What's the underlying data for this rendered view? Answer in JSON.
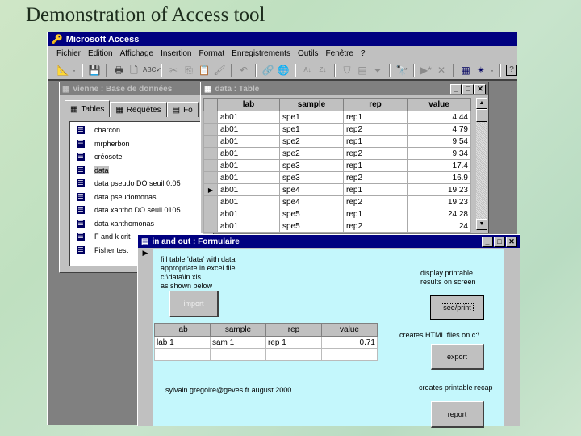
{
  "slide": {
    "title": "Demonstration of Access tool"
  },
  "app": {
    "title": "Microsoft Access",
    "menu": [
      "Fichier",
      "Edition",
      "Affichage",
      "Insertion",
      "Format",
      "Enregistrements",
      "Outils",
      "Fenêtre",
      "?"
    ],
    "toolbar_icons": [
      "design-view-icon",
      "dropdown-arrow-icon",
      "save-icon",
      "print-icon",
      "print-preview-icon",
      "spelling-icon",
      "cut-icon",
      "copy-icon",
      "paste-icon",
      "format-painter-icon",
      "undo-icon",
      "insert-hyperlink-icon",
      "web-toolbar-icon",
      "sort-ascending-icon",
      "sort-descending-icon",
      "filter-by-selection-icon",
      "filter-by-form-icon",
      "apply-filter-icon",
      "find-icon",
      "new-record-icon",
      "delete-record-icon",
      "database-window-icon",
      "new-object-icon",
      "new-object-dropdown-icon",
      "help-icon"
    ]
  },
  "database_window": {
    "title": "vienne : Base de données",
    "tabs": [
      {
        "label": "Tables",
        "active": true
      },
      {
        "label": "Requêtes",
        "active": false
      },
      {
        "label": "Fo",
        "active": false
      }
    ],
    "items": [
      {
        "label": "charcon",
        "selected": false
      },
      {
        "label": "mrpherbon",
        "selected": false
      },
      {
        "label": "créosote",
        "selected": false
      },
      {
        "label": "data",
        "selected": true
      },
      {
        "label": "data pseudo DO seuil 0.05",
        "selected": false
      },
      {
        "label": "data pseudomonas",
        "selected": false
      },
      {
        "label": "data xantho DO seuil 0105",
        "selected": false
      },
      {
        "label": "data xanthomonas",
        "selected": false
      },
      {
        "label": "F and k crit",
        "selected": false
      },
      {
        "label": "Fisher test",
        "selected": false
      }
    ]
  },
  "data_table": {
    "title": "data : Table",
    "columns": [
      "lab",
      "sample",
      "rep",
      "value"
    ],
    "rows": [
      [
        "ab01",
        "spe1",
        "rep1",
        "4.44"
      ],
      [
        "ab01",
        "spe1",
        "rep2",
        "4.79"
      ],
      [
        "ab01",
        "spe2",
        "rep1",
        "9.54"
      ],
      [
        "ab01",
        "spe2",
        "rep2",
        "9.34"
      ],
      [
        "ab01",
        "spe3",
        "rep1",
        "17.4"
      ],
      [
        "ab01",
        "spe3",
        "rep2",
        "16.9"
      ],
      [
        "ab01",
        "spe4",
        "rep1",
        "19.23"
      ],
      [
        "ab01",
        "spe4",
        "rep2",
        "19.23"
      ],
      [
        "ab01",
        "spe5",
        "rep1",
        "24.28"
      ],
      [
        "ab01",
        "spe5",
        "rep2",
        "24"
      ]
    ],
    "current_row_index": 6
  },
  "form": {
    "title": "in and out : Formulaire",
    "instructions": [
      "fill table 'data' with data",
      "appropriate in excel file",
      "c:\\data\\in.xls",
      "as shown below"
    ],
    "import_button": "import",
    "display_text": [
      "display printable",
      "results on screen"
    ],
    "see_print_button": "see/print",
    "export_text": "creates HTML files on c:\\",
    "export_button": "export",
    "recap_text": "creates printable recap",
    "report_button": "report",
    "credit": "sylvain.gregoire@geves.fr     august 2000",
    "example_table": {
      "columns": [
        "lab",
        "sample",
        "rep",
        "value"
      ],
      "rows": [
        [
          "lab 1",
          "sam 1",
          "rep 1",
          "0.71"
        ],
        [
          "",
          "",
          "",
          ""
        ]
      ]
    }
  }
}
